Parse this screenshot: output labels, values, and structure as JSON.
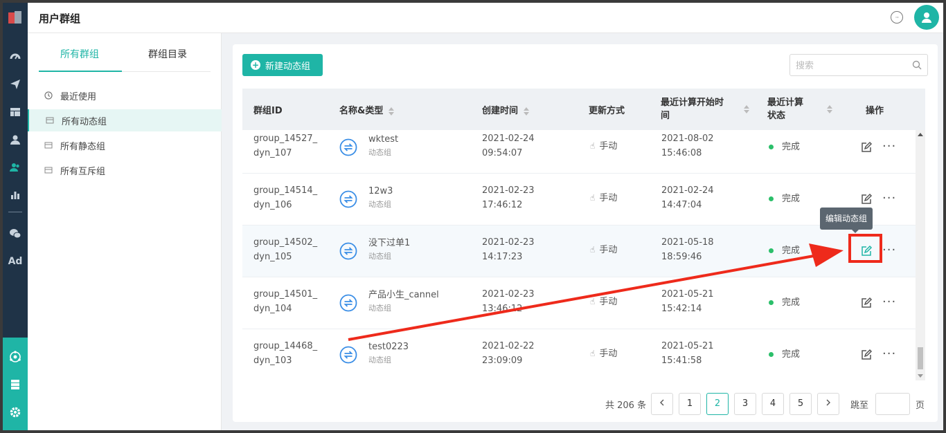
{
  "header": {
    "title": "用户群组"
  },
  "left_panel": {
    "tabs": [
      {
        "label": "所有群组"
      },
      {
        "label": "群组目录"
      }
    ],
    "nav": [
      {
        "label": "最近使用"
      },
      {
        "label": "所有动态组"
      },
      {
        "label": "所有静态组"
      },
      {
        "label": "所有互斥组"
      }
    ]
  },
  "toolbar": {
    "new_button": "新建动态组",
    "search_placeholder": "搜索"
  },
  "table": {
    "columns": [
      "群组ID",
      "名称&类型",
      "创建时间",
      "更新方式",
      "最近计算开始时间",
      "最近计算状态",
      "操作"
    ],
    "col_wrapped": {
      "start_time_line1": "最近计算开始时",
      "start_time_line2": "间",
      "status_line1": "最近计算",
      "status_line2": "状态"
    },
    "rows": [
      {
        "id_line1": "group_14527_",
        "id_line2": "dyn_107",
        "name": "wktest",
        "type": "动态组",
        "created_date": "2021-02-24",
        "created_time": "09:54:07",
        "update": "手动",
        "start_date": "2021-08-02",
        "start_time": "15:46:08",
        "status": "完成"
      },
      {
        "id_line1": "group_14514_",
        "id_line2": "dyn_106",
        "name": "12w3",
        "type": "动态组",
        "created_date": "2021-02-23",
        "created_time": "17:46:12",
        "update": "手动",
        "start_date": "2021-02-24",
        "start_time": "14:47:04",
        "status": "完成"
      },
      {
        "id_line1": "group_14502_",
        "id_line2": "dyn_105",
        "name": "没下过单1",
        "type": "动态组",
        "created_date": "2021-02-23",
        "created_time": "14:17:23",
        "update": "手动",
        "start_date": "2021-05-18",
        "start_time": "18:59:46",
        "status": "完成"
      },
      {
        "id_line1": "group_14501_",
        "id_line2": "dyn_104",
        "name": "产品小生_cannel",
        "type": "动态组",
        "created_date": "2021-02-23",
        "created_time": "13:46:12",
        "update": "手动",
        "start_date": "2021-05-21",
        "start_time": "15:42:14",
        "status": "完成"
      },
      {
        "id_line1": "group_14468_",
        "id_line2": "dyn_103",
        "name": "test0223",
        "type": "动态组",
        "created_date": "2021-02-22",
        "created_time": "23:09:09",
        "update": "手动",
        "start_date": "2021-05-21",
        "start_time": "15:41:58",
        "status": "完成"
      }
    ]
  },
  "tooltip": "编辑动态组",
  "pagination": {
    "total": "共 206 条",
    "pages": [
      "1",
      "2",
      "3",
      "4",
      "5"
    ],
    "current": "2",
    "jump_label": "跳至",
    "page_suffix": "页"
  },
  "colors": {
    "accent": "#1fb5a6",
    "sidebar": "#1f3347",
    "annotation": "#ee2a1b",
    "status_ok": "#2bbf6a"
  },
  "icons": {
    "rail": [
      "dashboard-icon",
      "send-icon",
      "layout-icon",
      "user-icon",
      "user-group-icon",
      "chart-icon",
      "wechat-icon",
      "ad-icon",
      "network-icon",
      "server-icon",
      "settings-icon"
    ]
  }
}
